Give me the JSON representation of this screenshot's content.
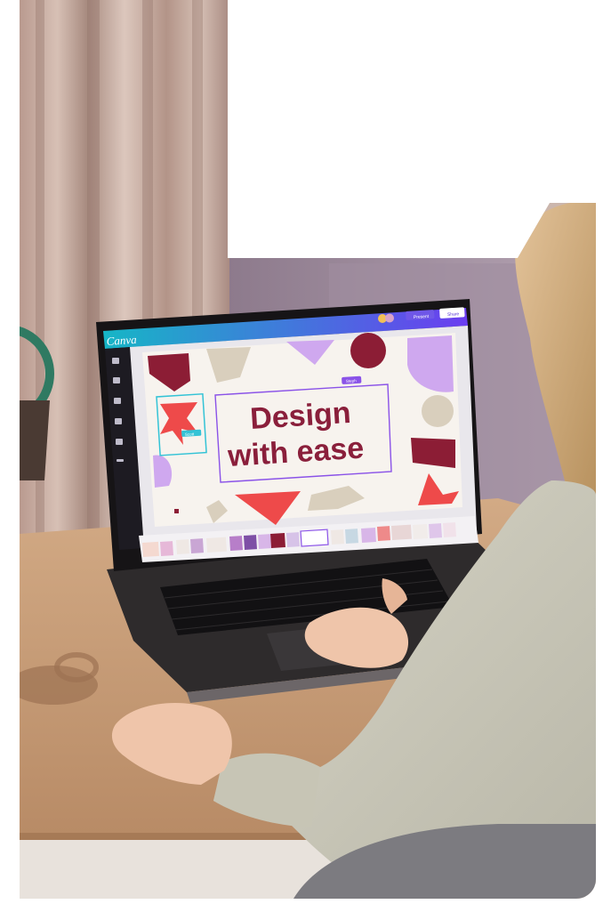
{
  "app": {
    "logo": "Canva",
    "share_label": "Share",
    "present_label": "Present"
  },
  "canvas": {
    "headline_line1": "Design",
    "headline_line2": "with ease",
    "collab_tag": "Steph",
    "collab_tag2": "Scott"
  },
  "colors": {
    "canva_gradient_start": "#16b6c6",
    "canva_gradient_end": "#6b3df0",
    "headline": "#8a1f3b",
    "maroon": "#8c1d35",
    "coral": "#ee4a4a",
    "lavender": "#cfa8ef",
    "beige": "#d9cfbd",
    "canvas_bg": "#f7f3ee",
    "selection": "#8a52e8"
  },
  "icons": {
    "sidebar": [
      "templates-icon",
      "design-icon",
      "elements-icon",
      "text-icon",
      "uploads-icon",
      "more-icon"
    ]
  }
}
